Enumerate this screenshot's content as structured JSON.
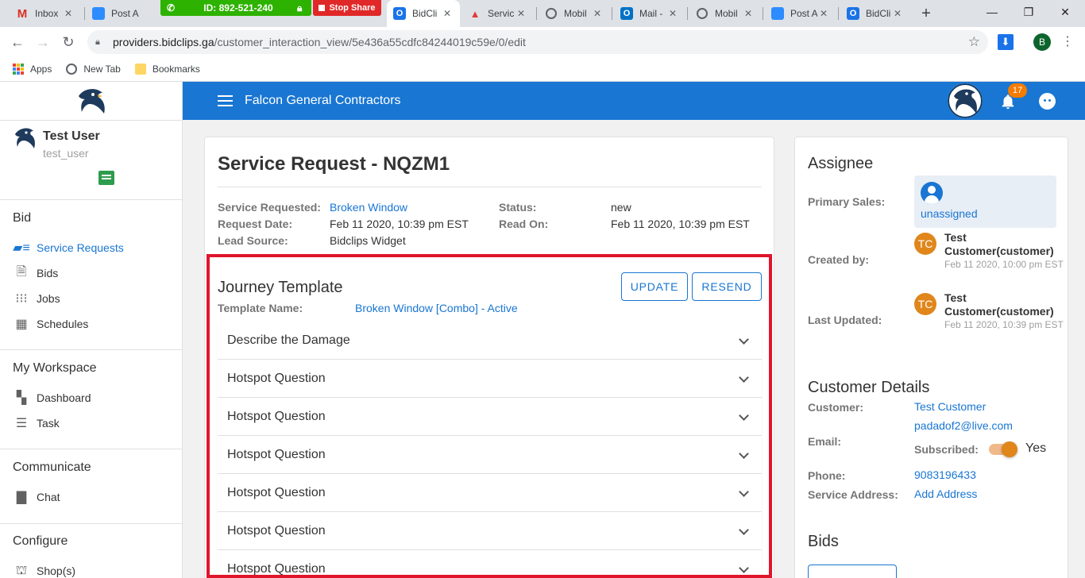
{
  "browser": {
    "tabs": [
      {
        "label": "Inbox",
        "fav": "M",
        "fav_color": "#d93025"
      },
      {
        "label": "Post A",
        "fav": "",
        "fav_color": "#2d8cff"
      },
      {
        "label": "BidCli",
        "fav": "",
        "fav_color": "#1a73e8"
      },
      {
        "label": "Servic",
        "fav": "",
        "fav_color": "#e53935"
      },
      {
        "label": "Mobil",
        "fav": "",
        "fav_color": "#5f6368"
      },
      {
        "label": "Mail -",
        "fav": "",
        "fav_color": "#0072c6"
      },
      {
        "label": "Mobil",
        "fav": "",
        "fav_color": "#5f6368"
      },
      {
        "label": "Post A",
        "fav": "",
        "fav_color": "#2d8cff"
      },
      {
        "label": "BidCli",
        "fav": "",
        "fav_color": "#1a73e8"
      }
    ],
    "zoom_meeting_id": "ID: 892-521-240",
    "stop_share_label": "Stop Share",
    "url_host": "providers.bidclips.ga",
    "url_path": "/customer_interaction_view/5e436a55cdfc84244019c59e/0/edit",
    "profile_initial": "B",
    "bookmarks": [
      "Apps",
      "New Tab",
      "Bookmarks"
    ]
  },
  "sidebar": {
    "user_name": "Test User",
    "user_handle": "test_user",
    "sections": {
      "bid": "Bid",
      "workspace": "My Workspace",
      "communicate": "Communicate",
      "configure": "Configure"
    },
    "items": {
      "service_requests": "Service Requests",
      "bids": "Bids",
      "jobs": "Jobs",
      "schedules": "Schedules",
      "dashboard": "Dashboard",
      "task": "Task",
      "chat": "Chat",
      "shops": "Shop(s)"
    }
  },
  "header": {
    "company": "Falcon General Contractors",
    "notifications": "17"
  },
  "request": {
    "title": "Service Request - NQZM1",
    "labels": {
      "service": "Service Requested:",
      "date": "Request Date:",
      "source": "Lead Source:",
      "status": "Status:",
      "read_on": "Read On:"
    },
    "service": "Broken Window",
    "date": "Feb 11 2020, 10:39 pm EST",
    "source": "Bidclips Widget",
    "status": "new",
    "read_on": "Feb 11 2020, 10:39 pm EST"
  },
  "journey": {
    "title": "Journey Template",
    "template_label": "Template Name:",
    "template_value": "Broken Window [Combo] - Active",
    "update_label": "UPDATE",
    "resend_label": "RESEND",
    "sections": [
      "Describe the Damage",
      "Hotspot Question",
      "Hotspot Question",
      "Hotspot Question",
      "Hotspot Question",
      "Hotspot Question",
      "Hotspot Question"
    ]
  },
  "assignee": {
    "title": "Assignee",
    "primary_label": "Primary Sales:",
    "primary_value": "unassigned",
    "created_label": "Created by:",
    "created_initials": "TC",
    "created_name": "Test Customer(customer)",
    "created_date": "Feb 11 2020, 10:00 pm EST",
    "updated_label": "Last Updated:",
    "updated_initials": "TC",
    "updated_name": "Test Customer(customer)",
    "updated_date": "Feb 11 2020, 10:39 pm EST"
  },
  "customer": {
    "title": "Customer Details",
    "customer_label": "Customer:",
    "customer_value": "Test Customer",
    "email_label": "Email:",
    "email_value": "padadof2@live.com",
    "subscribed_label": "Subscribed:",
    "subscribed_value": "Yes",
    "phone_label": "Phone:",
    "phone_value": "9083196433",
    "address_label": "Service Address:",
    "address_value": "Add Address"
  },
  "bids": {
    "title": "Bids"
  },
  "colors": {
    "primary": "#1976d2",
    "highlight": "#e0152b",
    "accent": "#e0861a"
  }
}
